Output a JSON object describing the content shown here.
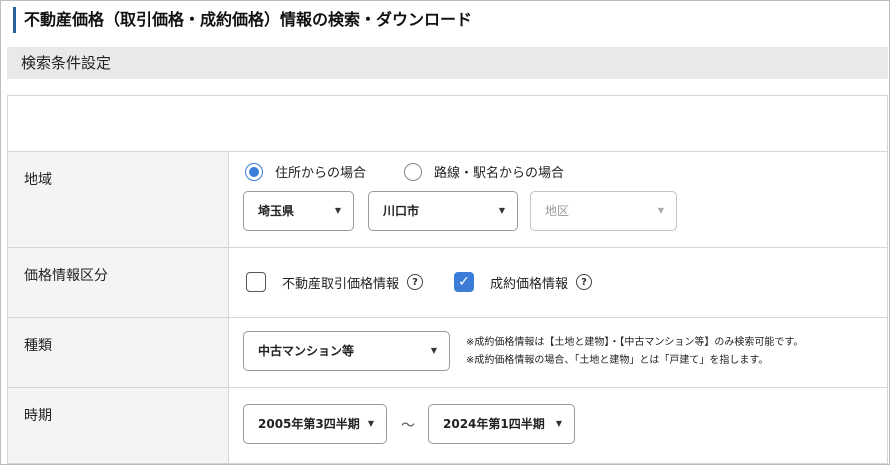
{
  "page": {
    "title": "不動産価格（取引価格・成約価格）情報の検索・ダウンロード"
  },
  "section": {
    "header": "検索条件設定"
  },
  "region": {
    "label": "地域",
    "radio_address": "住所からの場合",
    "radio_station": "路線・駅名からの場合",
    "selected": "address",
    "prefecture": "埼玉県",
    "city": "川口市",
    "district_placeholder": "地区"
  },
  "price_type": {
    "label": "価格情報区分",
    "transaction_label": "不動産取引価格情報",
    "transaction_checked": false,
    "contract_label": "成約価格情報",
    "contract_checked": true,
    "help_glyph": "?"
  },
  "kind": {
    "label": "種類",
    "selected": "中古マンション等",
    "note_line1": "※成約価格情報は【土地と建物】・【中古マンション等】のみ検索可能です。",
    "note_line2": "※成約価格情報の場合、「土地と建物」とは「戸建て」を指します。"
  },
  "period": {
    "label": "時期",
    "from": "2005年第3四半期",
    "separator": "～",
    "to": "2024年第1四半期"
  },
  "icons": {
    "caret": "▼",
    "check": "✓"
  },
  "colors": {
    "accent": "#3b7dd8",
    "title_bar": "#2a5f9e"
  }
}
